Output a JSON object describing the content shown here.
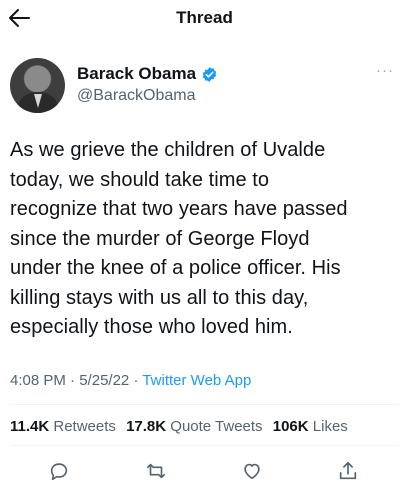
{
  "header": {
    "title": "Thread"
  },
  "author": {
    "name": "Barack Obama",
    "handle": "@BarackObama",
    "verified": true,
    "more_label": "···"
  },
  "tweet": {
    "lines": [
      "As we grieve the children of Uvalde",
      "today, we should take time to",
      "recognize that two years have passed",
      "since the murder of George Floyd",
      "under the knee of a police officer. His",
      "killing stays with us all to this day,",
      "especially those who loved him."
    ],
    "time": "4:08 PM",
    "date": "5/25/22",
    "separator": "·",
    "source": "Twitter Web App"
  },
  "stats": {
    "retweets_count": "11.4K",
    "retweets_label": "Retweets",
    "quotes_count": "17.8K",
    "quotes_label": "Quote Tweets",
    "likes_count": "106K",
    "likes_label": "Likes"
  },
  "colors": {
    "accent": "#1d9bf0",
    "text": "#0f1419",
    "muted": "#536471",
    "divider": "#eff3f4"
  },
  "icons": [
    "back-arrow-icon",
    "verified-badge-icon",
    "more-icon",
    "reply-icon",
    "retweet-icon",
    "like-icon",
    "share-icon"
  ]
}
